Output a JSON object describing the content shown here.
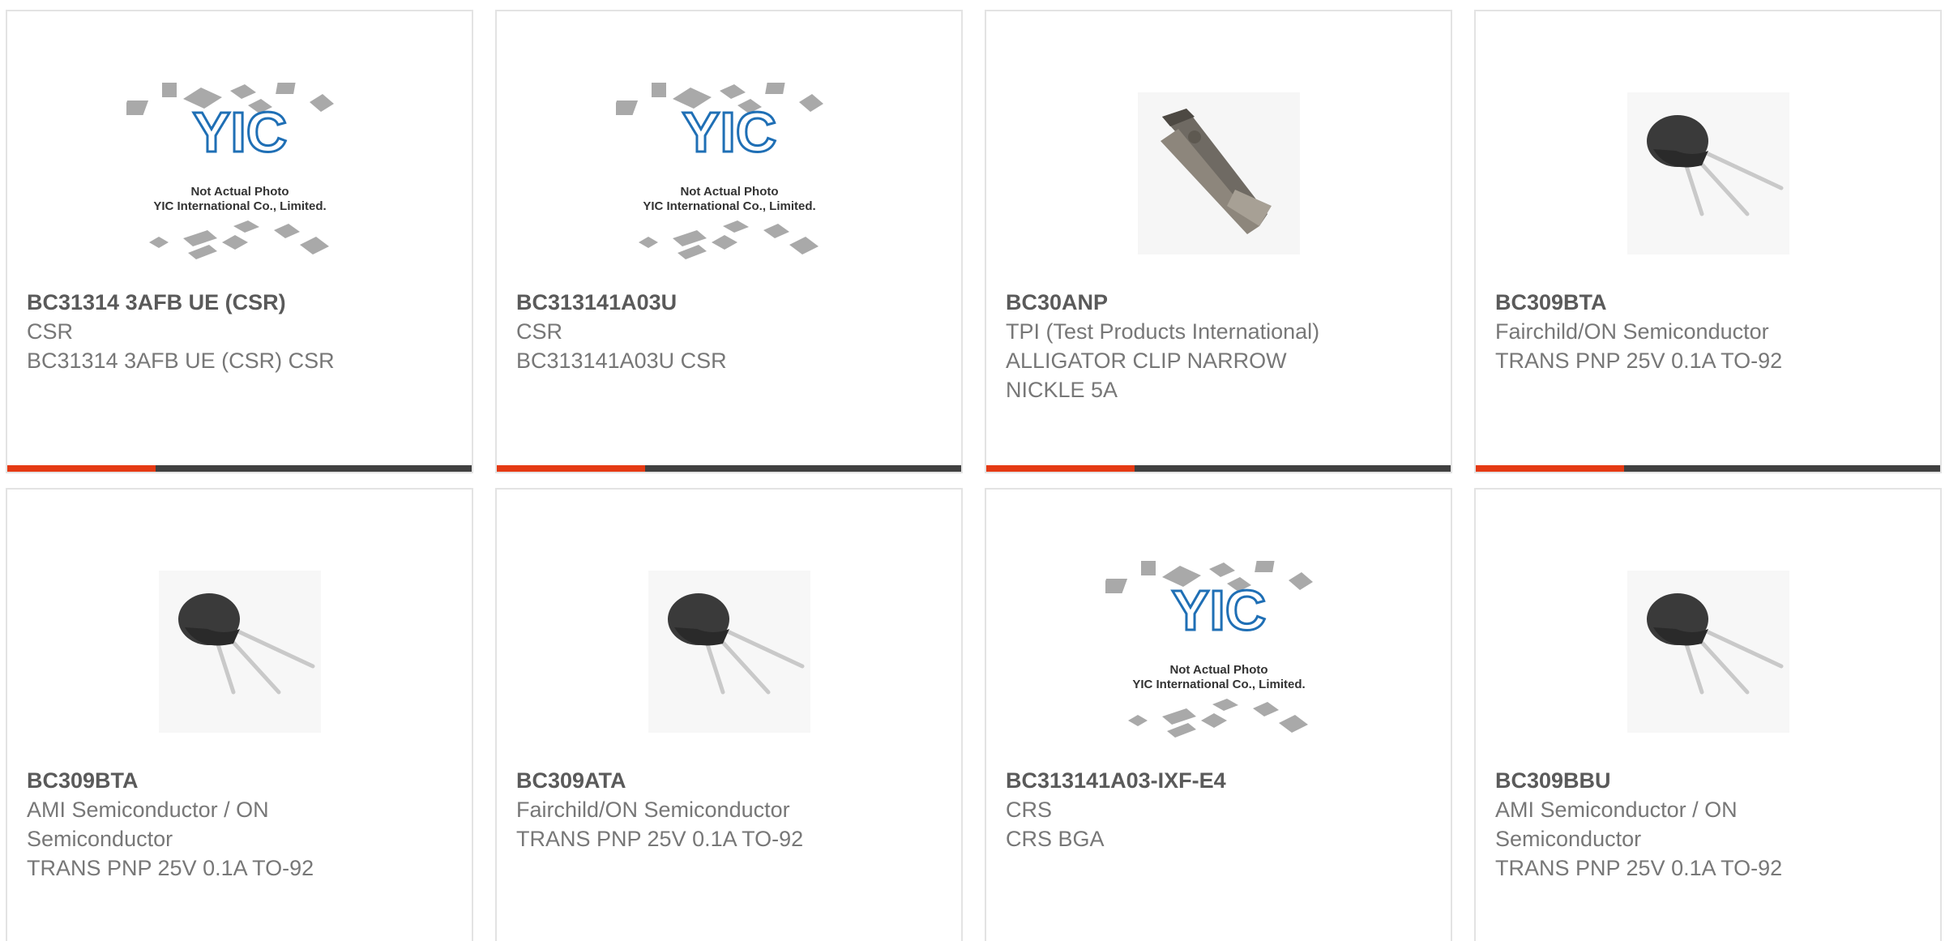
{
  "products": [
    {
      "part": "BC31314 3AFB UE (CSR)",
      "manufacturer": "CSR",
      "description": "BC31314 3AFB UE (CSR) CSR",
      "image": "placeholder-photo",
      "placeholder_line1": "Not Actual Photo",
      "placeholder_line2": "YIC International Co., Limited."
    },
    {
      "part": "BC313141A03U",
      "manufacturer": "CSR",
      "description": "BC313141A03U CSR",
      "image": "placeholder-photo",
      "placeholder_line1": "Not Actual Photo",
      "placeholder_line2": "YIC International Co., Limited."
    },
    {
      "part": "BC30ANP",
      "manufacturer": "TPI (Test Products International)",
      "description": "ALLIGATOR CLIP NARROW NICKLE 5A",
      "image": "alligator-clip-photo"
    },
    {
      "part": "BC309BTA",
      "manufacturer": "Fairchild/ON Semiconductor",
      "description": "TRANS PNP 25V 0.1A TO-92",
      "image": "to92-transistor-photo"
    },
    {
      "part": "BC309BTA",
      "manufacturer": "AMI Semiconductor / ON Semiconductor",
      "description": "TRANS PNP 25V 0.1A TO-92",
      "image": "to92-transistor-photo"
    },
    {
      "part": "BC309ATA",
      "manufacturer": "Fairchild/ON Semiconductor",
      "description": "TRANS PNP 25V 0.1A TO-92",
      "image": "to92-transistor-photo"
    },
    {
      "part": "BC313141A03-IXF-E4",
      "manufacturer": "CRS",
      "description": "CRS BGA",
      "image": "placeholder-photo",
      "placeholder_line1": "Not Actual Photo",
      "placeholder_line2": "YIC International Co., Limited."
    },
    {
      "part": "BC309BBU",
      "manufacturer": "AMI Semiconductor / ON Semiconductor",
      "description": "TRANS PNP 25V 0.1A TO-92",
      "image": "to92-transistor-photo"
    }
  ],
  "colors": {
    "accent": "#e53a14",
    "bar": "#404040",
    "logo_blue": "#1f6fb5"
  }
}
